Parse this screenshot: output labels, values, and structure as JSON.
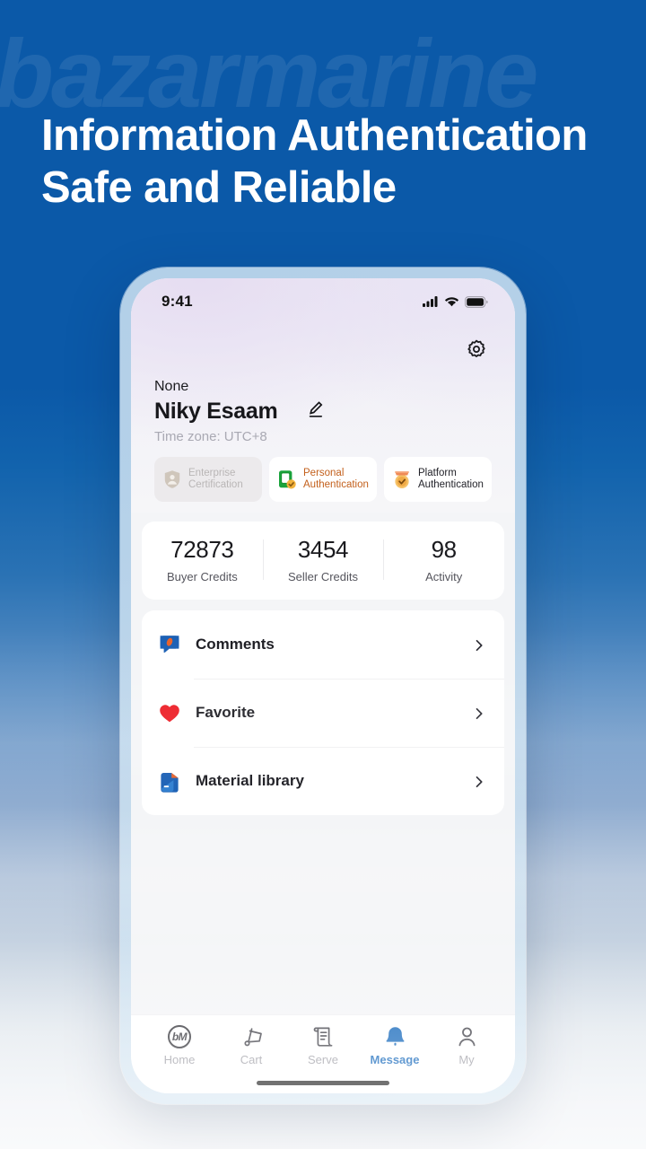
{
  "background": {
    "watermark_text": "bazarmarine",
    "brand_blue": "#0b59a8",
    "accent_blue": "#0a61b8"
  },
  "headline": {
    "text": "Information Authentication\nSafe and Reliable"
  },
  "phone": {
    "status_bar": {
      "time": "9:41",
      "signal_icon": "cellular-signal-icon",
      "wifi_icon": "wifi-icon",
      "battery_icon": "battery-full-icon"
    },
    "profile": {
      "settings_icon": "gear-icon",
      "company": "None",
      "name": "Niky Esaam",
      "edit_icon": "pencil-edit-icon",
      "timezone": "Time zone:  UTC+8",
      "badges": [
        {
          "label": "Enterprise\nCertification",
          "icon": "shield-person-icon",
          "state": "disabled",
          "color": "#b9b6b6"
        },
        {
          "label": "Personal\nAuthentication",
          "icon": "id-card-check-icon",
          "state": "verified",
          "color": "#c3601c"
        },
        {
          "label": "Platform\nAuthentication",
          "icon": "badge-check-icon",
          "state": "verified",
          "color": "#23232a"
        }
      ]
    },
    "stats": [
      {
        "value": "72873",
        "label": "Buyer Credits"
      },
      {
        "value": "3454",
        "label": "Seller Credits"
      },
      {
        "value": "98",
        "label": "Activity"
      }
    ],
    "menu": [
      {
        "label": "Comments",
        "icon": "comment-bubble-icon",
        "chevron": "chevron-right-icon"
      },
      {
        "label": "Favorite",
        "icon": "heart-icon",
        "chevron": "chevron-right-icon"
      },
      {
        "label": "Material library",
        "icon": "material-folder-icon",
        "chevron": "chevron-right-icon"
      }
    ],
    "tabbar": {
      "active_index": 3,
      "tabs": [
        {
          "label": "Home",
          "icon": "bm-logo-icon",
          "logo_text": "bM"
        },
        {
          "label": "Cart",
          "icon": "cart-icon"
        },
        {
          "label": "Serve",
          "icon": "document-icon"
        },
        {
          "label": "Message",
          "icon": "bell-icon"
        },
        {
          "label": "My",
          "icon": "person-icon"
        }
      ]
    }
  }
}
